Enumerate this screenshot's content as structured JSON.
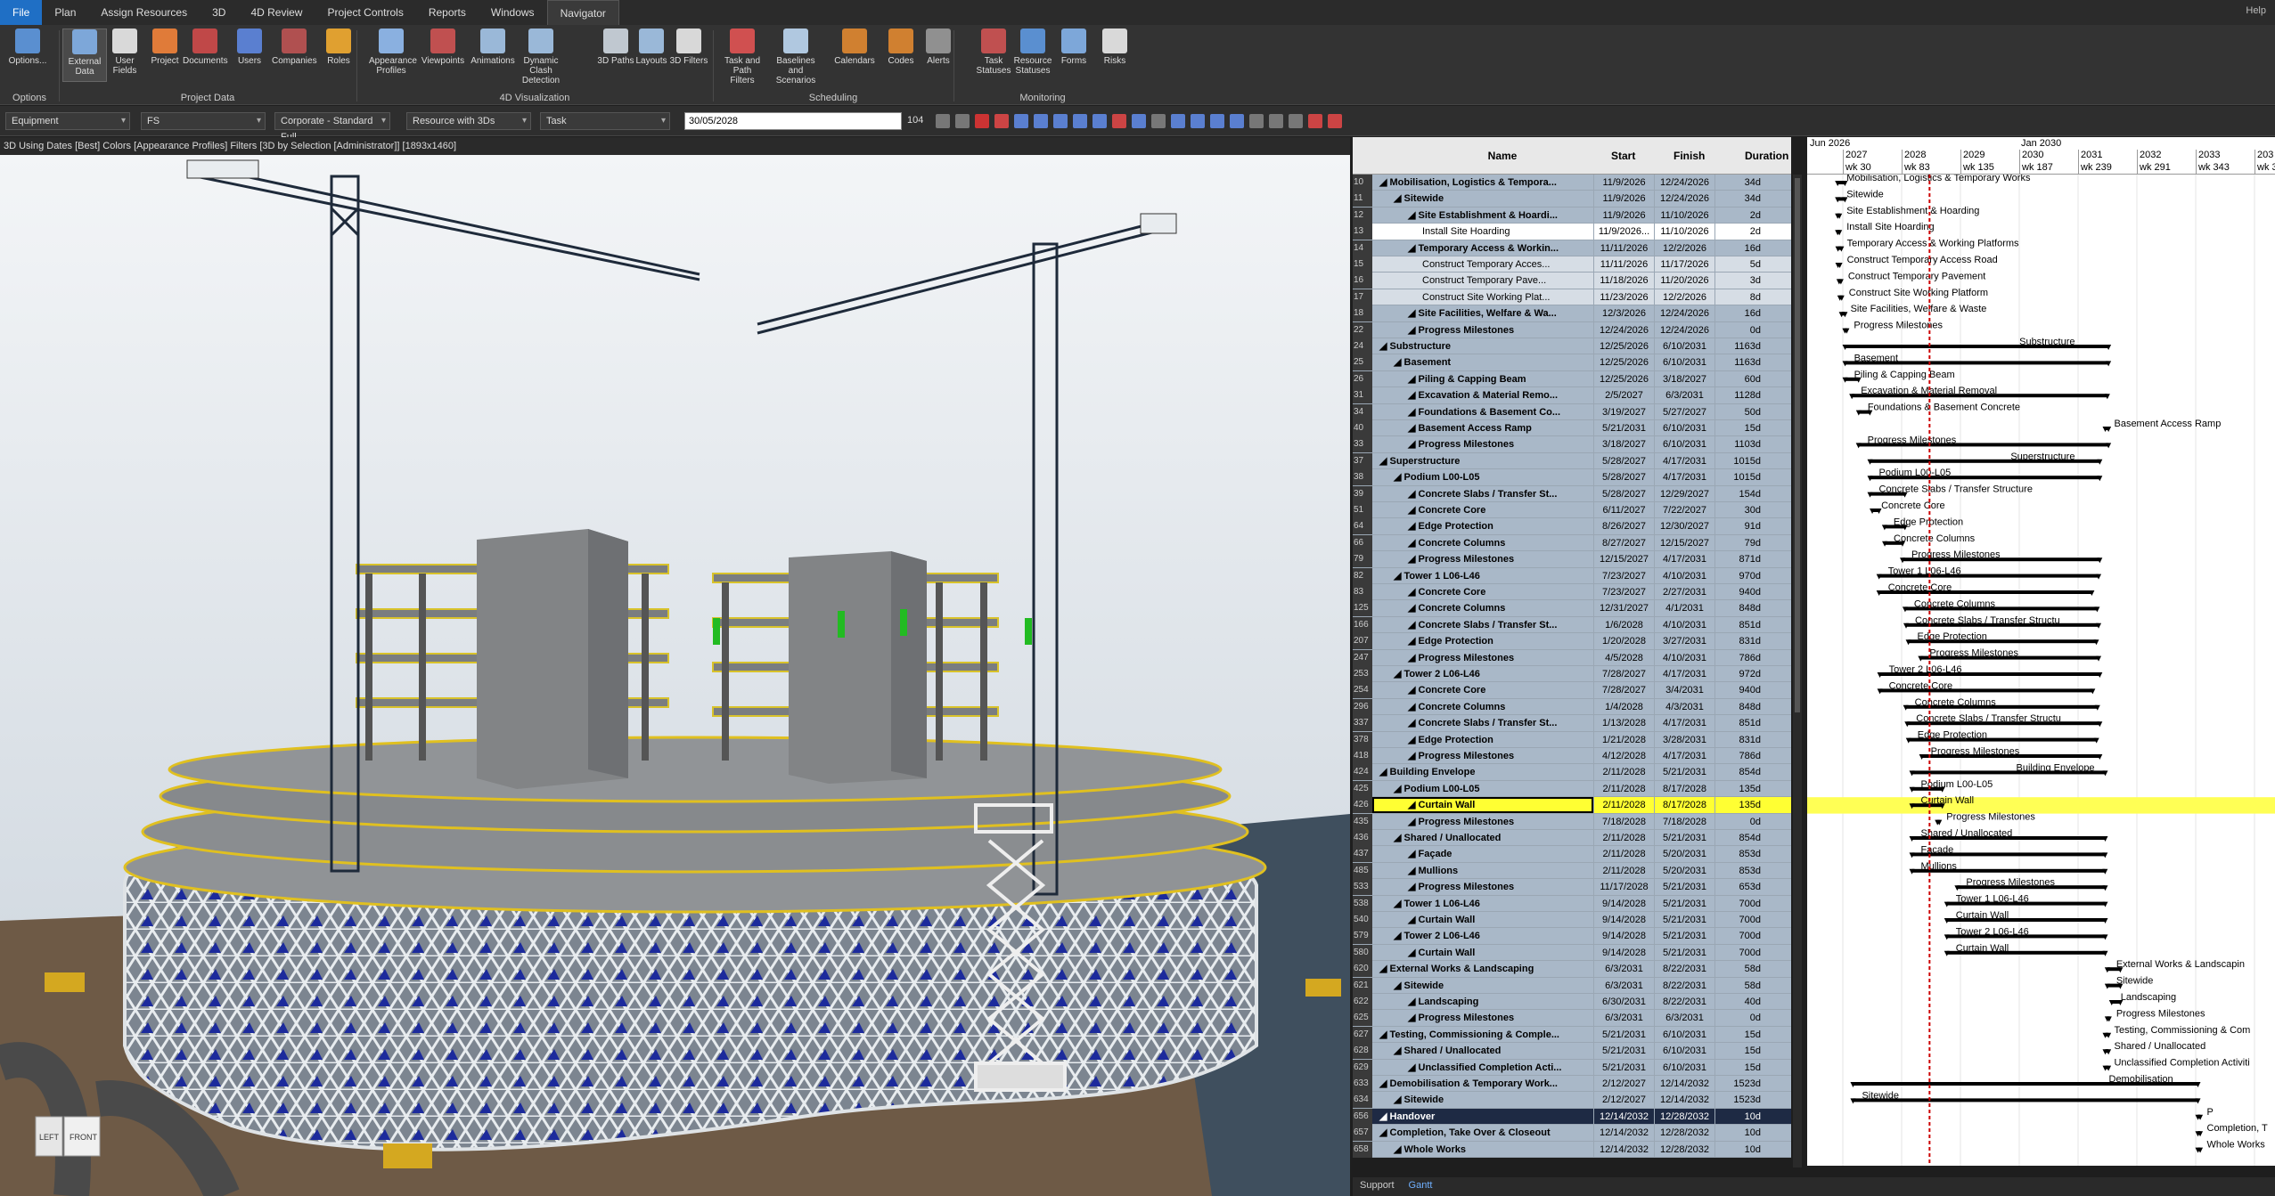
{
  "menu": {
    "items": [
      "File",
      "Plan",
      "Assign Resources",
      "3D",
      "4D Review",
      "Project Controls",
      "Reports",
      "Windows",
      "Navigator"
    ],
    "active": "Navigator",
    "help": "Help"
  },
  "ribbon": {
    "groups": [
      {
        "label": "Options",
        "buttons": [
          "Options..."
        ]
      },
      {
        "label": "Project Data",
        "buttons": [
          "External Data",
          "User Fields",
          "Project",
          "Documents",
          "Users",
          "Companies",
          "Roles"
        ]
      },
      {
        "label": "4D Visualization",
        "buttons": [
          "Appearance Profiles",
          "Viewpoints",
          "Animations",
          "Dynamic Clash Detection",
          "3D Paths",
          "Layouts",
          "3D Filters"
        ]
      },
      {
        "label": "Scheduling",
        "buttons": [
          "Task and Path Filters",
          "Baselines and Scenarios",
          "Calendars",
          "Codes",
          "Alerts"
        ]
      },
      {
        "label": "Monitoring",
        "buttons": [
          "Task Statuses",
          "Resource Statuses",
          "Forms",
          "Risks"
        ]
      }
    ]
  },
  "toolbar": {
    "combo1": "Equipment",
    "combo2": "FS",
    "combo3": "Corporate - Standard Full",
    "combo4": "Resource with 3Ds",
    "combo5": "Task",
    "date": "30/05/2028",
    "step": "104"
  },
  "view3d": {
    "title": "3D Using Dates [Best] Colors [Appearance Profiles] Filters [3D by Selection [Administrator]]  [1893x1460]",
    "nav_cube_left": "LEFT",
    "nav_cube_front": "FRONT"
  },
  "grid": {
    "headers": {
      "name": "Name",
      "start": "Start",
      "finish": "Finish",
      "duration": "Duration"
    },
    "rows": [
      {
        "n": "10",
        "name": "Mobilisation, Logistics & Tempora...",
        "s": "11/9/2026",
        "f": "12/24/2026",
        "d": "34d",
        "lvl": 0,
        "type": "summary"
      },
      {
        "n": "11",
        "name": "Sitewide",
        "s": "11/9/2026",
        "f": "12/24/2026",
        "d": "34d",
        "lvl": 1,
        "type": "summary"
      },
      {
        "n": "12",
        "name": "Site Establishment & Hoardi...",
        "s": "11/9/2026",
        "f": "11/10/2026",
        "d": "2d",
        "lvl": 2,
        "type": "summary"
      },
      {
        "n": "13",
        "name": "Install Site Hoarding",
        "s": "11/9/2026...",
        "f": "11/10/2026",
        "d": "2d",
        "lvl": 3,
        "type": "task_white"
      },
      {
        "n": "14",
        "name": "Temporary Access & Workin...",
        "s": "11/11/2026",
        "f": "12/2/2026",
        "d": "16d",
        "lvl": 2,
        "type": "summary"
      },
      {
        "n": "15",
        "name": "Construct Temporary Acces...",
        "s": "11/11/2026",
        "f": "11/17/2026",
        "d": "5d",
        "lvl": 3,
        "type": "task"
      },
      {
        "n": "16",
        "name": "Construct Temporary Pave...",
        "s": "11/18/2026",
        "f": "11/20/2026",
        "d": "3d",
        "lvl": 3,
        "type": "task"
      },
      {
        "n": "17",
        "name": "Construct Site Working Plat...",
        "s": "11/23/2026",
        "f": "12/2/2026",
        "d": "8d",
        "lvl": 3,
        "type": "task"
      },
      {
        "n": "18",
        "name": "Site Facilities, Welfare & Wa...",
        "s": "12/3/2026",
        "f": "12/24/2026",
        "d": "16d",
        "lvl": 2,
        "type": "summary"
      },
      {
        "n": "22",
        "name": "Progress Milestones",
        "s": "12/24/2026",
        "f": "12/24/2026",
        "d": "0d",
        "lvl": 2,
        "type": "summary"
      },
      {
        "n": "24",
        "name": "Substructure",
        "s": "12/25/2026",
        "f": "6/10/2031",
        "d": "1163d",
        "lvl": 0,
        "type": "summary"
      },
      {
        "n": "25",
        "name": "Basement",
        "s": "12/25/2026",
        "f": "6/10/2031",
        "d": "1163d",
        "lvl": 1,
        "type": "summary"
      },
      {
        "n": "26",
        "name": "Piling & Capping Beam",
        "s": "12/25/2026",
        "f": "3/18/2027",
        "d": "60d",
        "lvl": 2,
        "type": "summary"
      },
      {
        "n": "31",
        "name": "Excavation & Material Remo...",
        "s": "2/5/2027",
        "f": "6/3/2031",
        "d": "1128d",
        "lvl": 2,
        "type": "summary"
      },
      {
        "n": "34",
        "name": "Foundations & Basement Co...",
        "s": "3/19/2027",
        "f": "5/27/2027",
        "d": "50d",
        "lvl": 2,
        "type": "summary"
      },
      {
        "n": "40",
        "name": "Basement Access Ramp",
        "s": "5/21/2031",
        "f": "6/10/2031",
        "d": "15d",
        "lvl": 2,
        "type": "summary"
      },
      {
        "n": "33",
        "name": "Progress Milestones",
        "s": "3/18/2027",
        "f": "6/10/2031",
        "d": "1103d",
        "lvl": 2,
        "type": "summary"
      },
      {
        "n": "37",
        "name": "Superstructure",
        "s": "5/28/2027",
        "f": "4/17/2031",
        "d": "1015d",
        "lvl": 0,
        "type": "summary"
      },
      {
        "n": "38",
        "name": "Podium L00-L05",
        "s": "5/28/2027",
        "f": "4/17/2031",
        "d": "1015d",
        "lvl": 1,
        "type": "summary"
      },
      {
        "n": "39",
        "name": "Concrete Slabs / Transfer St...",
        "s": "5/28/2027",
        "f": "12/29/2027",
        "d": "154d",
        "lvl": 2,
        "type": "summary"
      },
      {
        "n": "51",
        "name": "Concrete Core",
        "s": "6/11/2027",
        "f": "7/22/2027",
        "d": "30d",
        "lvl": 2,
        "type": "summary"
      },
      {
        "n": "64",
        "name": "Edge Protection",
        "s": "8/26/2027",
        "f": "12/30/2027",
        "d": "91d",
        "lvl": 2,
        "type": "summary"
      },
      {
        "n": "66",
        "name": "Concrete Columns",
        "s": "8/27/2027",
        "f": "12/15/2027",
        "d": "79d",
        "lvl": 2,
        "type": "summary"
      },
      {
        "n": "79",
        "name": "Progress Milestones",
        "s": "12/15/2027",
        "f": "4/17/2031",
        "d": "871d",
        "lvl": 2,
        "type": "summary"
      },
      {
        "n": "82",
        "name": "Tower 1 L06-L46",
        "s": "7/23/2027",
        "f": "4/10/2031",
        "d": "970d",
        "lvl": 1,
        "type": "summary"
      },
      {
        "n": "83",
        "name": "Concrete Core",
        "s": "7/23/2027",
        "f": "2/27/2031",
        "d": "940d",
        "lvl": 2,
        "type": "summary"
      },
      {
        "n": "125",
        "name": "Concrete Columns",
        "s": "12/31/2027",
        "f": "4/1/2031",
        "d": "848d",
        "lvl": 2,
        "type": "summary"
      },
      {
        "n": "166",
        "name": "Concrete Slabs / Transfer St...",
        "s": "1/6/2028",
        "f": "4/10/2031",
        "d": "851d",
        "lvl": 2,
        "type": "summary"
      },
      {
        "n": "207",
        "name": "Edge Protection",
        "s": "1/20/2028",
        "f": "3/27/2031",
        "d": "831d",
        "lvl": 2,
        "type": "summary"
      },
      {
        "n": "247",
        "name": "Progress Milestones",
        "s": "4/5/2028",
        "f": "4/10/2031",
        "d": "786d",
        "lvl": 2,
        "type": "summary"
      },
      {
        "n": "253",
        "name": "Tower 2 L06-L46",
        "s": "7/28/2027",
        "f": "4/17/2031",
        "d": "972d",
        "lvl": 1,
        "type": "summary"
      },
      {
        "n": "254",
        "name": "Concrete Core",
        "s": "7/28/2027",
        "f": "3/4/2031",
        "d": "940d",
        "lvl": 2,
        "type": "summary"
      },
      {
        "n": "296",
        "name": "Concrete Columns",
        "s": "1/4/2028",
        "f": "4/3/2031",
        "d": "848d",
        "lvl": 2,
        "type": "summary"
      },
      {
        "n": "337",
        "name": "Concrete Slabs / Transfer St...",
        "s": "1/13/2028",
        "f": "4/17/2031",
        "d": "851d",
        "lvl": 2,
        "type": "summary"
      },
      {
        "n": "378",
        "name": "Edge Protection",
        "s": "1/21/2028",
        "f": "3/28/2031",
        "d": "831d",
        "lvl": 2,
        "type": "summary"
      },
      {
        "n": "418",
        "name": "Progress Milestones",
        "s": "4/12/2028",
        "f": "4/17/2031",
        "d": "786d",
        "lvl": 2,
        "type": "summary"
      },
      {
        "n": "424",
        "name": "Building Envelope",
        "s": "2/11/2028",
        "f": "5/21/2031",
        "d": "854d",
        "lvl": 0,
        "type": "summary"
      },
      {
        "n": "425",
        "name": "Podium L00-L05",
        "s": "2/11/2028",
        "f": "8/17/2028",
        "d": "135d",
        "lvl": 1,
        "type": "summary"
      },
      {
        "n": "426",
        "name": "Curtain Wall",
        "s": "2/11/2028",
        "f": "8/17/2028",
        "d": "135d",
        "lvl": 2,
        "type": "selected"
      },
      {
        "n": "435",
        "name": "Progress Milestones",
        "s": "7/18/2028",
        "f": "7/18/2028",
        "d": "0d",
        "lvl": 2,
        "type": "summary"
      },
      {
        "n": "436",
        "name": "Shared / Unallocated",
        "s": "2/11/2028",
        "f": "5/21/2031",
        "d": "854d",
        "lvl": 1,
        "type": "summary"
      },
      {
        "n": "437",
        "name": "Façade",
        "s": "2/11/2028",
        "f": "5/20/2031",
        "d": "853d",
        "lvl": 2,
        "type": "summary"
      },
      {
        "n": "485",
        "name": "Mullions",
        "s": "2/11/2028",
        "f": "5/20/2031",
        "d": "853d",
        "lvl": 2,
        "type": "summary"
      },
      {
        "n": "533",
        "name": "Progress Milestones",
        "s": "11/17/2028",
        "f": "5/21/2031",
        "d": "653d",
        "lvl": 2,
        "type": "summary"
      },
      {
        "n": "538",
        "name": "Tower 1 L06-L46",
        "s": "9/14/2028",
        "f": "5/21/2031",
        "d": "700d",
        "lvl": 1,
        "type": "summary"
      },
      {
        "n": "540",
        "name": "Curtain Wall",
        "s": "9/14/2028",
        "f": "5/21/2031",
        "d": "700d",
        "lvl": 2,
        "type": "summary"
      },
      {
        "n": "579",
        "name": "Tower 2 L06-L46",
        "s": "9/14/2028",
        "f": "5/21/2031",
        "d": "700d",
        "lvl": 1,
        "type": "summary"
      },
      {
        "n": "580",
        "name": "Curtain Wall",
        "s": "9/14/2028",
        "f": "5/21/2031",
        "d": "700d",
        "lvl": 2,
        "type": "summary"
      },
      {
        "n": "620",
        "name": "External Works & Landscaping",
        "s": "6/3/2031",
        "f": "8/22/2031",
        "d": "58d",
        "lvl": 0,
        "type": "summary"
      },
      {
        "n": "621",
        "name": "Sitewide",
        "s": "6/3/2031",
        "f": "8/22/2031",
        "d": "58d",
        "lvl": 1,
        "type": "summary"
      },
      {
        "n": "622",
        "name": "Landscaping",
        "s": "6/30/2031",
        "f": "8/22/2031",
        "d": "40d",
        "lvl": 2,
        "type": "summary"
      },
      {
        "n": "625",
        "name": "Progress Milestones",
        "s": "6/3/2031",
        "f": "6/3/2031",
        "d": "0d",
        "lvl": 2,
        "type": "summary"
      },
      {
        "n": "627",
        "name": "Testing, Commissioning & Comple...",
        "s": "5/21/2031",
        "f": "6/10/2031",
        "d": "15d",
        "lvl": 0,
        "type": "summary"
      },
      {
        "n": "628",
        "name": "Shared / Unallocated",
        "s": "5/21/2031",
        "f": "6/10/2031",
        "d": "15d",
        "lvl": 1,
        "type": "summary"
      },
      {
        "n": "629",
        "name": "Unclassified Completion Acti...",
        "s": "5/21/2031",
        "f": "6/10/2031",
        "d": "15d",
        "lvl": 2,
        "type": "summary"
      },
      {
        "n": "633",
        "name": "Demobilisation & Temporary Work...",
        "s": "2/12/2027",
        "f": "12/14/2032",
        "d": "1523d",
        "lvl": 0,
        "type": "summary"
      },
      {
        "n": "634",
        "name": "Sitewide",
        "s": "2/12/2027",
        "f": "12/14/2032",
        "d": "1523d",
        "lvl": 1,
        "type": "summary"
      },
      {
        "n": "656",
        "name": "Handover",
        "s": "12/14/2032",
        "f": "12/28/2032",
        "d": "10d",
        "lvl": 0,
        "type": "dark"
      },
      {
        "n": "657",
        "name": "Completion, Take Over & Closeout",
        "s": "12/14/2032",
        "f": "12/28/2032",
        "d": "10d",
        "lvl": 0,
        "type": "summary"
      },
      {
        "n": "658",
        "name": "Whole Works",
        "s": "12/14/2032",
        "f": "12/28/2032",
        "d": "10d",
        "lvl": 1,
        "type": "summary"
      }
    ]
  },
  "gantt": {
    "top_labels": [
      "Jun 2026",
      "Jan 2030"
    ],
    "years": [
      "2027",
      "2028",
      "2029",
      "2030",
      "2031",
      "2032",
      "2033",
      "203"
    ],
    "weeks": [
      "wk 30",
      "wk 83",
      "wk 135",
      "wk 187",
      "wk 239",
      "wk 291",
      "wk 343",
      "wk 3"
    ],
    "bar_labels": [
      "Mobilisation, Logistics & Temporary Works",
      "Sitewide",
      "Site Establishment & Hoarding",
      "Install Site Hoarding",
      "Temporary Access & Working Platforms",
      "Construct Temporary Access Road",
      "Construct Temporary Pavement",
      "Construct Site Working Platform",
      "Site Facilities, Welfare & Waste",
      "Progress Milestones",
      "Substructure",
      "Basement",
      "Piling & Capping Beam",
      "Excavation & Material Removal",
      "Foundations & Basement Concrete",
      "Basement Access Ramp",
      "Progress Milestones",
      "Superstructure",
      "Podium L00-L05",
      "Concrete Slabs / Transfer Structure",
      "Concrete Core",
      "Edge Protection",
      "Concrete Columns",
      "Progress Milestones",
      "Tower 1 L06-L46",
      "Concrete Core",
      "Concrete Columns",
      "Concrete Slabs / Transfer Structu",
      "Edge Protection",
      "Progress Milestones",
      "Tower 2 L06-L46",
      "Concrete Core",
      "Concrete Columns",
      "Concrete Slabs / Transfer Structu",
      "Edge Protection",
      "Progress Milestones",
      "Building Envelope",
      "Podium L00-L05",
      "Curtain Wall",
      "Progress Milestones",
      "Shared / Unallocated",
      "Façade",
      "Mullions",
      "Progress Milestones",
      "Tower 1 L06-L46",
      "Curtain Wall",
      "Tower 2 L06-L46",
      "Curtain Wall",
      "External Works & Landscapin",
      "Sitewide",
      "Landscaping",
      "Progress Milestones",
      "Testing, Commissioning & Com",
      "Shared / Unallocated",
      "Unclassified Completion Activiti",
      "Demobilisation",
      "Sitewide",
      "P",
      "Completion, T",
      "Whole Works"
    ]
  },
  "bottom_tabs": [
    "Support",
    "Gantt"
  ],
  "colors": {
    "accent": "#1f6fc5",
    "summary_row": "#a9b8c8",
    "task_row": "#d6dde5",
    "selected": "#ffff33",
    "dark_row": "#1e2a44",
    "today_line": "#cc0000"
  }
}
